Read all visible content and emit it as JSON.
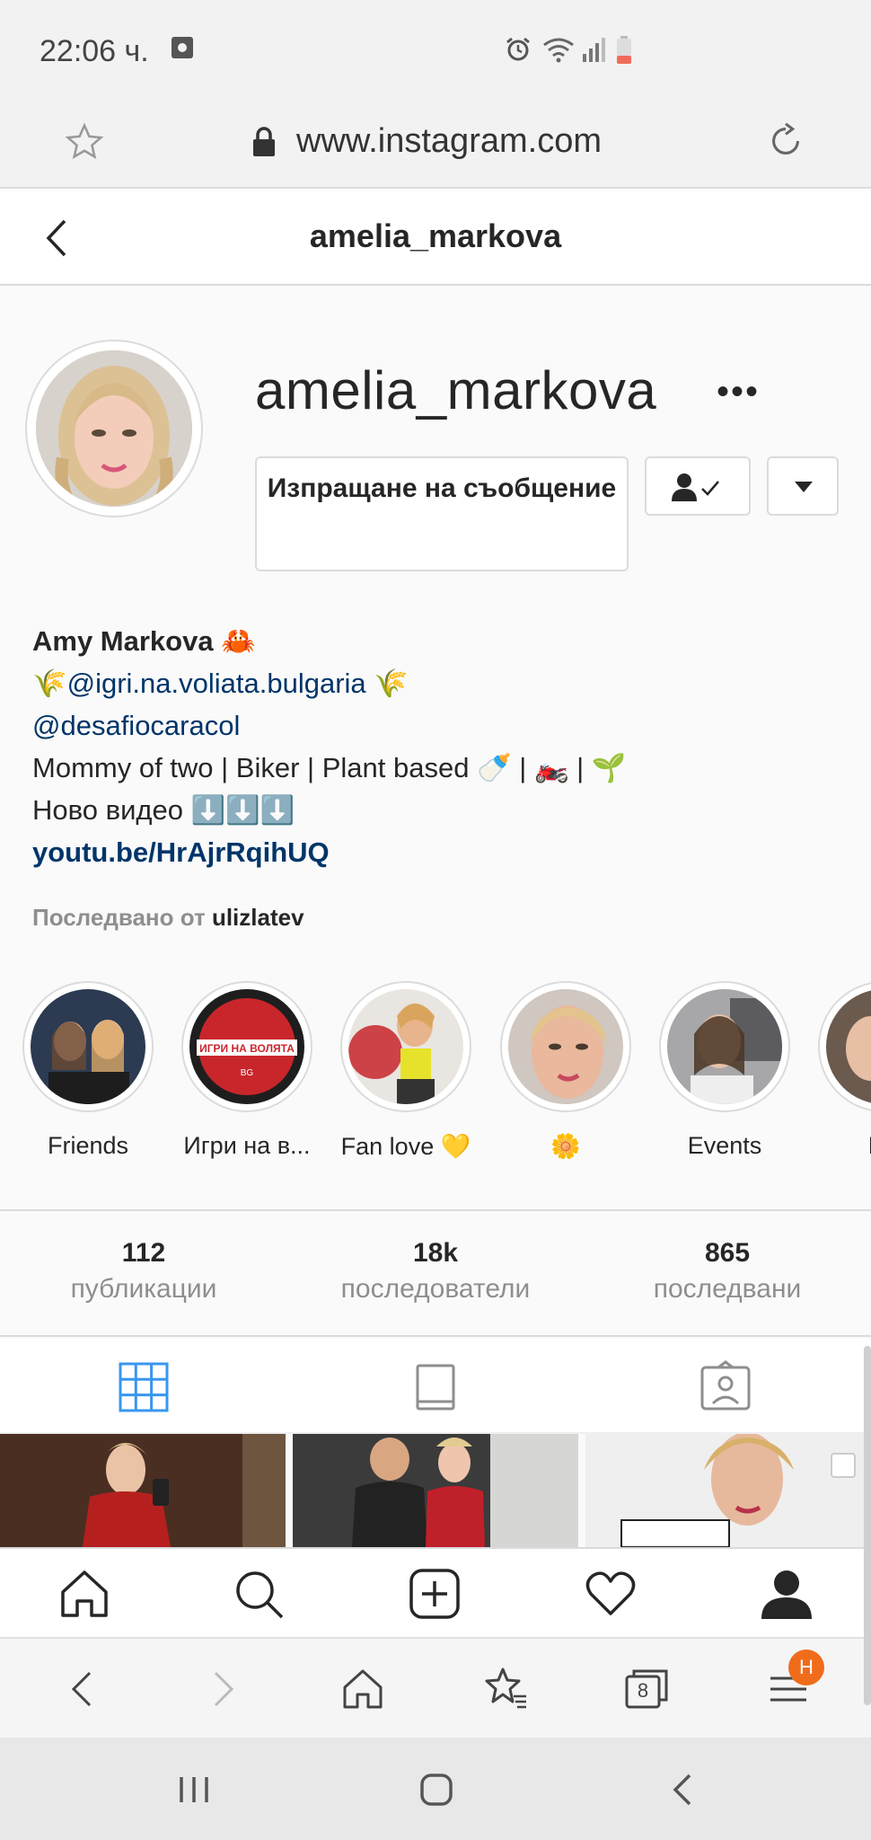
{
  "status_bar": {
    "time": "22:06 ч."
  },
  "browser": {
    "url": "www.instagram.com"
  },
  "header": {
    "title": "amelia_markova"
  },
  "profile": {
    "username": "amelia_markova",
    "message_button": "Изпращане на съобщение",
    "bio": {
      "name": "Amy Markova 🦀",
      "line1_prefix": "🌾",
      "line1_link": "@igri.na.voliata.bulgaria",
      "line1_suffix": " 🌾",
      "line2_link": "@desafiocaracol",
      "line3": "Mommy of two | Biker | Plant based 🍼 | 🏍️ | 🌱",
      "line4": "Ново видео ⬇️⬇️⬇️",
      "website": "youtu.be/HrAjrRqihUQ"
    },
    "followed_by_label": "Последвано от",
    "followed_by_user": "ulizlatev"
  },
  "highlights": [
    {
      "label": "Friends"
    },
    {
      "label": "Игри на в..."
    },
    {
      "label": "Fan love 💛"
    },
    {
      "label": "🌼"
    },
    {
      "label": "Events"
    },
    {
      "label": "Da"
    }
  ],
  "stats": {
    "posts_count": "112",
    "posts_label": "публикации",
    "followers_count": "18k",
    "followers_label": "последователи",
    "following_count": "865",
    "following_label": "последвани"
  },
  "highlight_art": {
    "igri_logo_text": "ИГРИ НА ВОЛЯТА",
    "igri_logo_sub": "BG"
  },
  "browser_nav": {
    "tabs_count": "8",
    "badge": "Н"
  },
  "colors": {
    "link": "#003569",
    "accent_blue": "#3897f0",
    "badge_orange": "#ef6c1a"
  }
}
